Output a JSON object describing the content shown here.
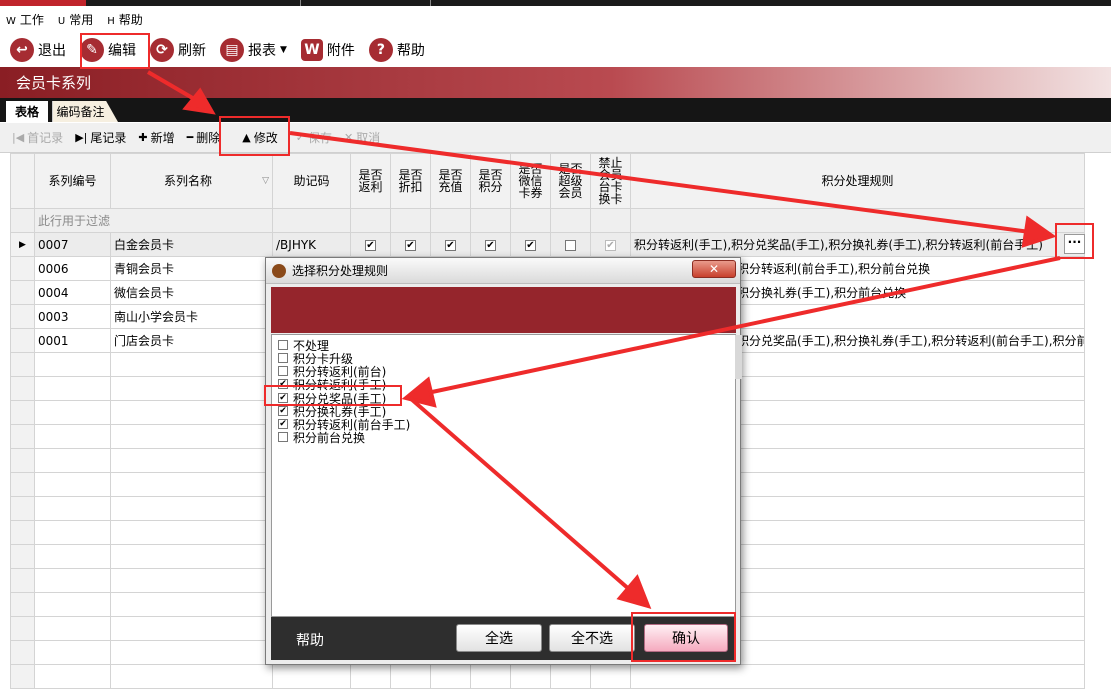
{
  "menu": [
    {
      "key": "W",
      "label": "工作"
    },
    {
      "key": "U",
      "label": "常用"
    },
    {
      "key": "H",
      "label": "帮助"
    }
  ],
  "toolbar": {
    "exit": "退出",
    "edit": "编辑",
    "refresh": "刷新",
    "report": "报表",
    "attach": "附件",
    "help": "帮助"
  },
  "banner_title": "会员卡系列",
  "tabs": {
    "grid": "表格",
    "note": "编码备注"
  },
  "nav": {
    "first": "首记录",
    "last": "尾记录",
    "add": "新增",
    "delete": "删除",
    "modify": "修改",
    "save": "保存",
    "cancel": "取消"
  },
  "grid": {
    "columns": {
      "code": "系列编号",
      "name": "系列名称",
      "mnemonic": "助记码",
      "rebate": "是否返利",
      "discount": "是否折扣",
      "recharge": "是否充值",
      "points": "是否积分",
      "wechat_coupon": "是否微信卡券",
      "super_member": "是否超级会员",
      "no_convert": "禁止会员台卡换卡",
      "rules": "积分处理规则"
    },
    "filter_hint": "此行用于过滤",
    "rows": [
      {
        "code": "0007",
        "name": "白金会员卡",
        "mnemonic": "/BJHYK",
        "rebate": true,
        "discount": true,
        "recharge": true,
        "points": true,
        "wechat": true,
        "super": false,
        "noconv": true,
        "rules": "积分转返利(手工),积分兑奖品(手工),积分换礼券(手工),积分转返利(前台手工)"
      },
      {
        "code": "0006",
        "name": "青铜会员卡",
        "rules": "积分转返利(前台手工),积分前台兑换"
      },
      {
        "code": "0004",
        "name": "微信会员卡",
        "rules": "积分换礼券(手工),积分前台兑换"
      },
      {
        "code": "0003",
        "name": "南山小学会员卡",
        "rules": ""
      },
      {
        "code": "0001",
        "name": "门店会员卡",
        "rules": "积分兑奖品(手工),积分换礼券(手工),积分转返利(前台手工),积分前台"
      }
    ],
    "ellipsis": "···"
  },
  "dialog": {
    "title": "选择积分处理规则",
    "close": "✕",
    "options": [
      {
        "label": "不处理",
        "checked": false
      },
      {
        "label": "积分卡升级",
        "checked": false
      },
      {
        "label": "积分转返利(前台)",
        "checked": false
      },
      {
        "label": "积分转返利(手工)",
        "checked": true
      },
      {
        "label": "积分兑奖品(手工)",
        "checked": true
      },
      {
        "label": "积分换礼券(手工)",
        "checked": true
      },
      {
        "label": "积分转返利(前台手工)",
        "checked": true
      },
      {
        "label": "积分前台兑换",
        "checked": false
      }
    ],
    "help": "帮助",
    "select_all": "全选",
    "select_none": "全不选",
    "confirm": "确认"
  },
  "colors": {
    "brand": "#a62c32",
    "highlight": "#ee2b2b"
  }
}
